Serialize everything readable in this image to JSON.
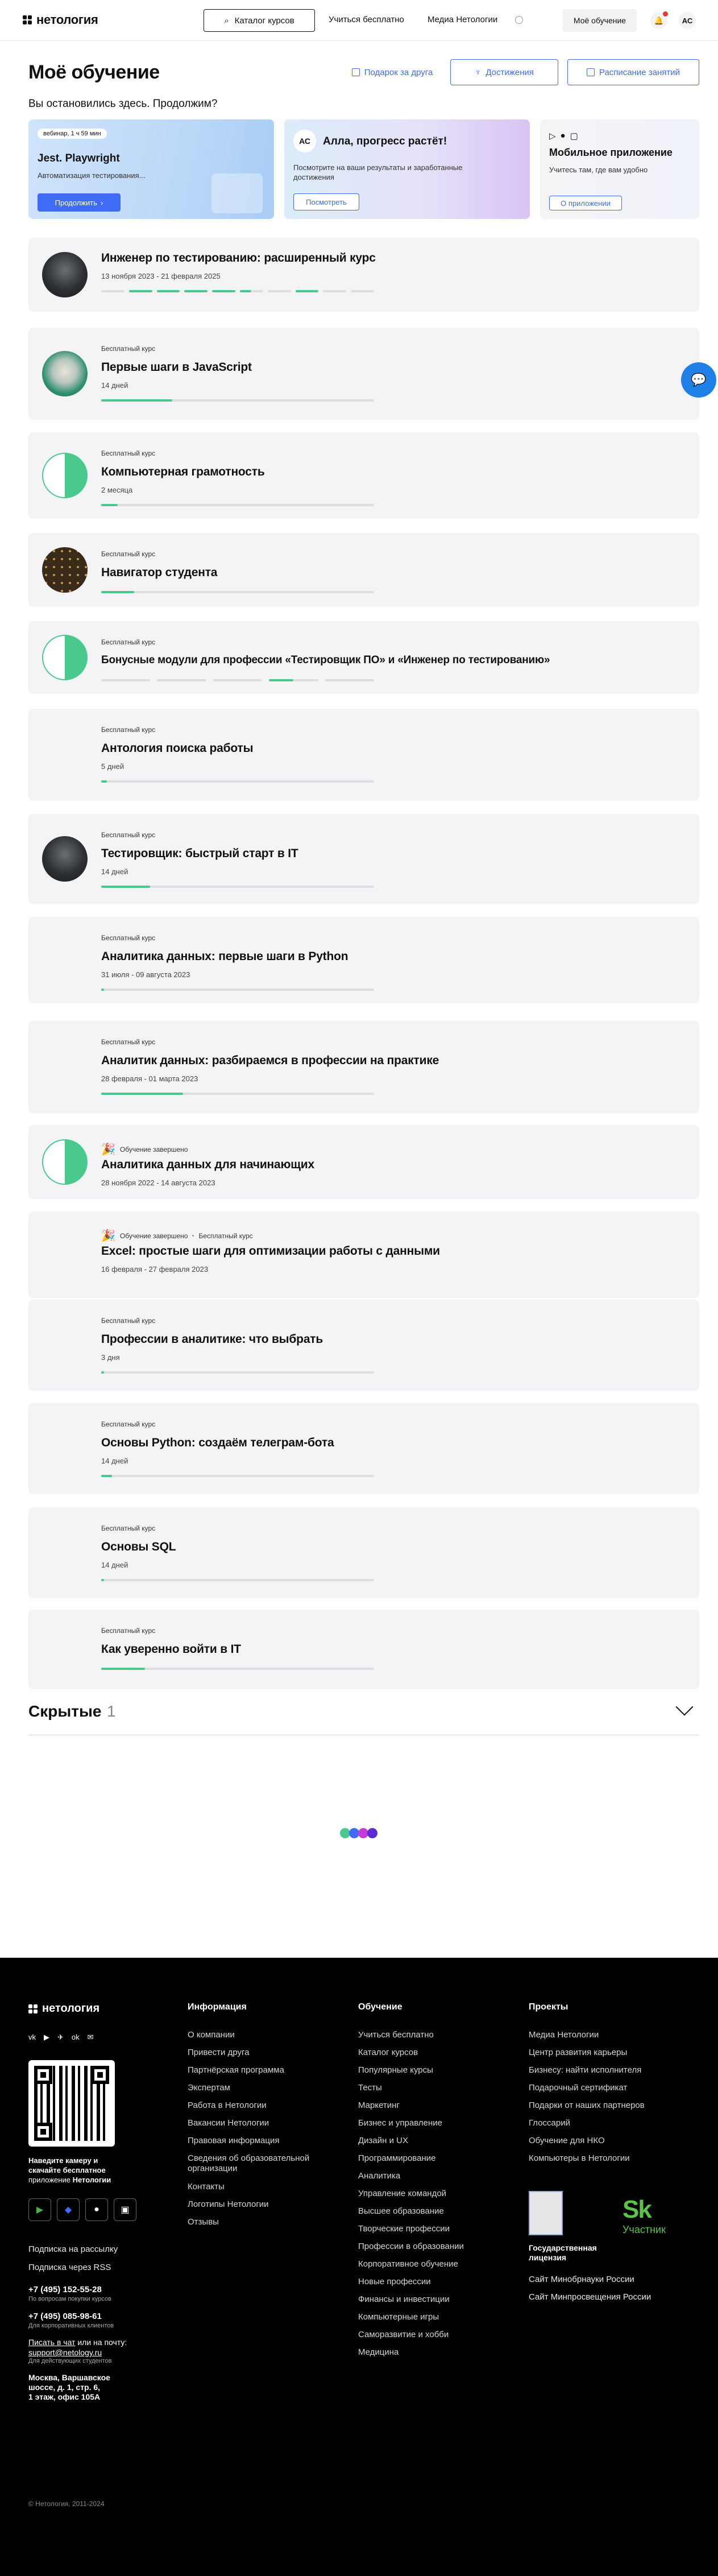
{
  "header": {
    "logo": "нетология",
    "catalog": "Каталог курсов",
    "free": "Учиться бесплатно",
    "media": "Медиа Нетологии",
    "my_learning": "Моё обучение",
    "avatar": "АС"
  },
  "page": {
    "title": "Моё обучение",
    "subtitle": "Вы остановились здесь. Продолжим?",
    "actions": {
      "gift": "Подарок за друга",
      "achievements": "Достижения",
      "schedule": "Расписание занятий"
    }
  },
  "promos": {
    "webinar": {
      "badge": "вебинар, 1 ч 59 мин",
      "title": "Jest. Playwright",
      "text": "Автоматизация тестирования...",
      "button": "Продолжить"
    },
    "progress": {
      "avatar": "АС",
      "title": "Алла, прогресс растёт!",
      "text": "Посмотрите на ваши результаты и заработанные достижения",
      "button": "Посмотреть"
    },
    "app": {
      "title": "Мобильное приложение",
      "text": "Учитесь там, где вам удобно",
      "button": "О приложении"
    }
  },
  "courses": [
    {
      "badge": "",
      "title": "Инженер по тестированию: расширенный курс",
      "date": "13 ноября 2023 - 21 февраля 2025",
      "thumb": "photo",
      "progress_segments": [
        0,
        1,
        1,
        1,
        1,
        2,
        0,
        1,
        0,
        0
      ]
    },
    {
      "badge": "Бесплатный курс",
      "title": "Первые шаги в JavaScript",
      "date": "14 дней",
      "thumb": "teal",
      "progress": 0.26
    },
    {
      "badge": "Бесплатный курс",
      "title": "Компьютерная грамотность",
      "date": "2 месяца",
      "thumb": "split",
      "progress": 0.06
    },
    {
      "badge": "Бесплатный курс",
      "title": "Навигатор студента",
      "date": "",
      "thumb": "dots",
      "progress": 0.12
    },
    {
      "badge": "Бесплатный курс",
      "title": "Бонусные модули для профессии «Тестировщик ПО» и «Инженер по тестированию»",
      "date": "",
      "thumb": "split",
      "progress_segments": [
        0,
        0,
        0,
        2,
        0
      ]
    },
    {
      "badge": "Бесплатный курс",
      "title": "Антология поиска работы",
      "date": "5 дней",
      "thumb": "light",
      "progress": 0.02
    },
    {
      "badge": "Бесплатный курс",
      "title": "Тестировщик: быстрый старт в IT",
      "date": "14 дней",
      "thumb": "photo",
      "progress": 0.18
    },
    {
      "badge": "Бесплатный курс",
      "title": "Аналитика данных: первые шаги в Python",
      "date": "31 июля - 09 августа 2023",
      "thumb": "light",
      "progress": 0.0
    },
    {
      "badge": "Бесплатный курс",
      "title": "Аналитик данных: разбираемся в профессии на практике",
      "date": "28 февраля - 01 марта 2023",
      "thumb": "light",
      "progress": 0.3
    },
    {
      "badge": "Обучение завершено",
      "title": "Аналитика данных для начинающих",
      "date": "28 ноября 2022 - 14 августа 2023",
      "thumb": "split",
      "completed": true
    },
    {
      "badge": "Обучение завершено",
      "badge2": "Бесплатный курс",
      "title": "Excel: простые шаги для оптимизации работы с данными",
      "date": "16 февраля - 27 февраля 2023",
      "thumb": "light",
      "completed": true
    },
    {
      "badge": "Бесплатный курс",
      "title": "Профессии в аналитике: что выбрать",
      "date": "3 дня",
      "thumb": "light",
      "progress": 0.0
    },
    {
      "badge": "Бесплатный курс",
      "title": "Основы Python: создаём телеграм-бота",
      "date": "14 дней",
      "thumb": "light",
      "progress": 0.04
    },
    {
      "badge": "Бесплатный курс",
      "title": "Основы SQL",
      "date": "14 дней",
      "thumb": "light",
      "progress": 0.01
    },
    {
      "badge": "Бесплатный курс",
      "title": "Как уверенно войти в IT",
      "date": "",
      "thumb": "light",
      "progress": 0.16
    }
  ],
  "hidden": {
    "title": "Скрытые",
    "count": "1"
  },
  "footer": {
    "logo": "нетология",
    "social": [
      "vk",
      "▶",
      "✈",
      "ok",
      "✉"
    ],
    "qr_text_1": "Наведите камеру и",
    "qr_text_2": "скачайте бесплатное",
    "qr_text_3": "приложение",
    "qr_text_brand": "Нетологии",
    "subscribe": "Подписка на рассылку",
    "rss": "Подписка через RSS",
    "phone1": "+7 (495) 152-55-28",
    "phone1_note": "По вопросам покупки курсов",
    "phone2": "+7 (495) 085-98-61",
    "phone2_note": "Для корпоративных клиентов",
    "write_chat": "Писать в чат",
    "or_mail": "или на почту:",
    "email": "support@netology.ru",
    "email_note": "Для действующих студентов",
    "address_1": "Москва, Варшавское",
    "address_2": "шоссе, д. 1, стр. 6,",
    "address_3": "1 этаж, офис 105А",
    "col1_title": "Информация",
    "col1": [
      "О компании",
      "Привести друга",
      "Партнёрская программа",
      "Экспертам",
      "Работа в Нетологии",
      "Вакансии Нетологии",
      "Правовая информация",
      "Сведения об образовательной организации",
      "Контакты",
      "Логотипы Нетологии",
      "Отзывы"
    ],
    "col2_title": "Обучение",
    "col2": [
      "Учиться бесплатно",
      "Каталог курсов",
      "Популярные курсы",
      "Тесты",
      "Маркетинг",
      "Бизнес и управление",
      "Дизайн и UX",
      "Программирование",
      "Аналитика",
      "Управление командой",
      "Высшее образование",
      "Творческие профессии",
      "Профессии в образовании",
      "Корпоративное обучение",
      "Новые профессии",
      "Финансы и инвестиции",
      "Компьютерные игры",
      "Саморазвитие и хобби",
      "Медицина"
    ],
    "col3_title": "Проекты",
    "col3": [
      "Медиа Нетологии",
      "Центр развития карьеры",
      "Бизнесу: найти исполнителя",
      "Подарочный сертификат",
      "Подарки от наших партнеров",
      "Глоссарий",
      "Обучение для НКО",
      "Компьютеры в Нетологии"
    ],
    "licence_1": "Государственная",
    "licence_2": "лицензия",
    "sk_logo": "Sk",
    "sk_sub": "Участник",
    "ministry1": "Сайт Минобрнауки России",
    "ministry2": "Сайт Минпросвещения России",
    "copyright": "© Нетология, 2011-2024"
  },
  "colors": {
    "accent": "#3f6bf5",
    "progress": "#49c98d",
    "footer_bg": "#000000"
  }
}
